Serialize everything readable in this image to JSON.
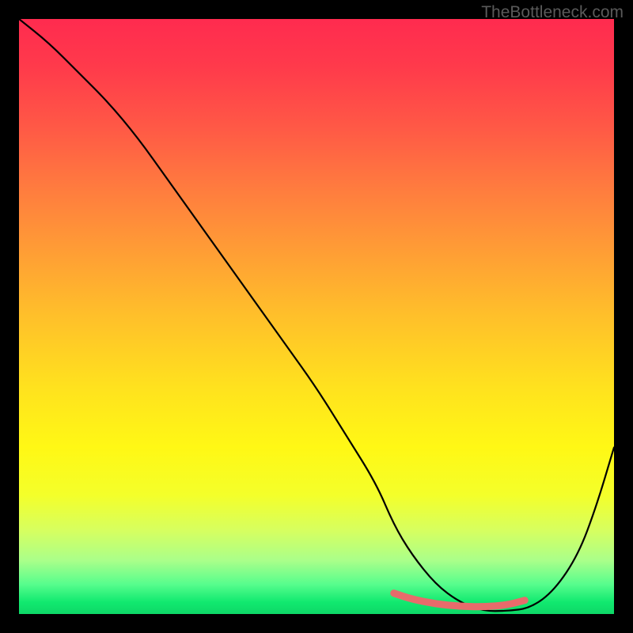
{
  "watermark": "TheBottleneck.com",
  "chart_data": {
    "type": "line",
    "title": "",
    "xlabel": "",
    "ylabel": "",
    "x_range": [
      0,
      100
    ],
    "y_range": [
      0,
      100
    ],
    "series": [
      {
        "name": "bottleneck-curve",
        "color": "#000000",
        "x": [
          0,
          5,
          10,
          15,
          20,
          25,
          30,
          35,
          40,
          45,
          50,
          55,
          60,
          63,
          66,
          70,
          74,
          78,
          82,
          86,
          90,
          94,
          97,
          100
        ],
        "y": [
          100,
          96,
          91,
          86,
          80,
          73,
          66,
          59,
          52,
          45,
          38,
          30,
          22,
          15,
          10,
          5,
          2,
          0.5,
          0.5,
          1,
          4,
          10,
          18,
          28
        ]
      },
      {
        "name": "highlight-segment",
        "color": "#e86b6b",
        "x": [
          63,
          66,
          70,
          74,
          78,
          82,
          85
        ],
        "y": [
          3.5,
          2.5,
          1.7,
          1.3,
          1.2,
          1.5,
          2.3
        ]
      }
    ],
    "gradient_stops": [
      {
        "pos": 0,
        "color": "#ff2b4f"
      },
      {
        "pos": 50,
        "color": "#ffc02a"
      },
      {
        "pos": 80,
        "color": "#f4ff2a"
      },
      {
        "pos": 100,
        "color": "#0ed767"
      }
    ]
  }
}
